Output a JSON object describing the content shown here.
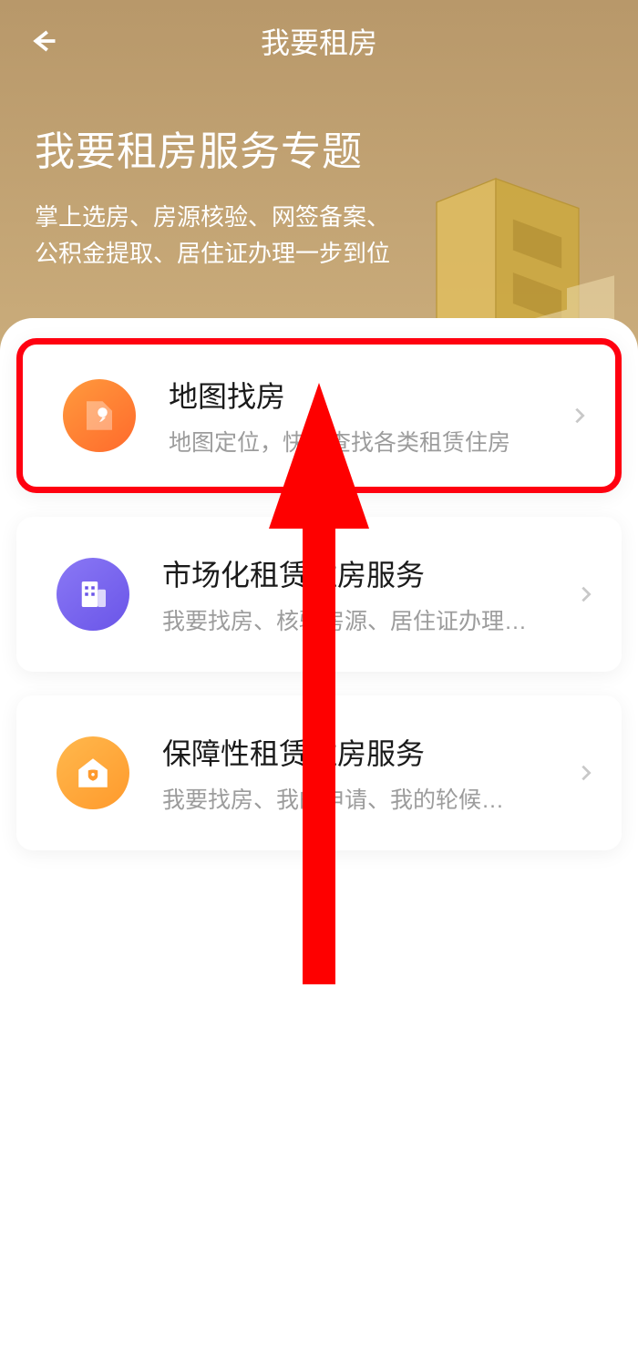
{
  "navbar": {
    "title": "我要租房"
  },
  "header": {
    "title": "我要租房服务专题",
    "subtitle_line1": "掌上选房、房源核验、网签备案、",
    "subtitle_line2": "公积金提取、居住证办理一步到位"
  },
  "list": [
    {
      "icon": "map-pin-icon",
      "icon_color": "orange",
      "title": "地图找房",
      "desc": "地图定位，快捷查找各类租赁住房",
      "highlighted": true
    },
    {
      "icon": "building-icon",
      "icon_color": "purple",
      "title": "市场化租赁住房服务",
      "desc": "我要找房、核验房源、居住证办理…",
      "highlighted": false
    },
    {
      "icon": "house-shield-icon",
      "icon_color": "amber",
      "title": "保障性租赁住房服务",
      "desc": "我要找房、我的申请、我的轮候…",
      "highlighted": false
    }
  ],
  "colors": {
    "brand_gradient_top": "#b8986a",
    "highlight_border": "#ff0010",
    "arrow": "#fe0000"
  }
}
